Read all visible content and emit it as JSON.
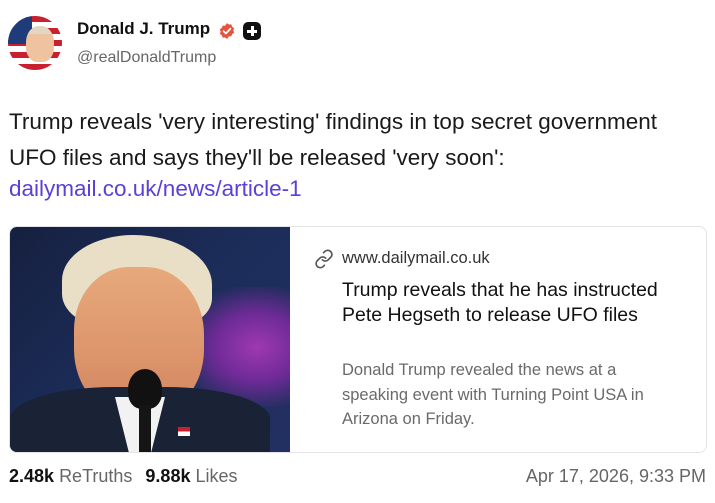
{
  "author": {
    "display_name": "Donald J. Trump",
    "handle": "@realDonaldTrump",
    "verified_icon": "verified-badge-icon",
    "extra_badge_icon": "plus-badge-icon",
    "verified_color": "#e5533f"
  },
  "post": {
    "text": "Trump reveals 'very interesting' findings in top secret government UFO files and says they'll be released 'very soon':",
    "link_text": "dailymail.co.uk/news/article-1",
    "link_color": "#5b3fd6"
  },
  "card": {
    "domain": "www.dailymail.co.uk",
    "title": "Trump reveals that he has instructed Pete Hegseth to release UFO files",
    "description": "Donald Trump revealed the news at a speaking event with Turning Point USA in Arizona on Friday.",
    "icon": "link-icon"
  },
  "footer": {
    "retruths_count": "2.48k",
    "retruths_label": "ReTruths",
    "likes_count": "9.88k",
    "likes_label": "Likes",
    "timestamp": "Apr 17, 2026, 9:33 PM"
  }
}
